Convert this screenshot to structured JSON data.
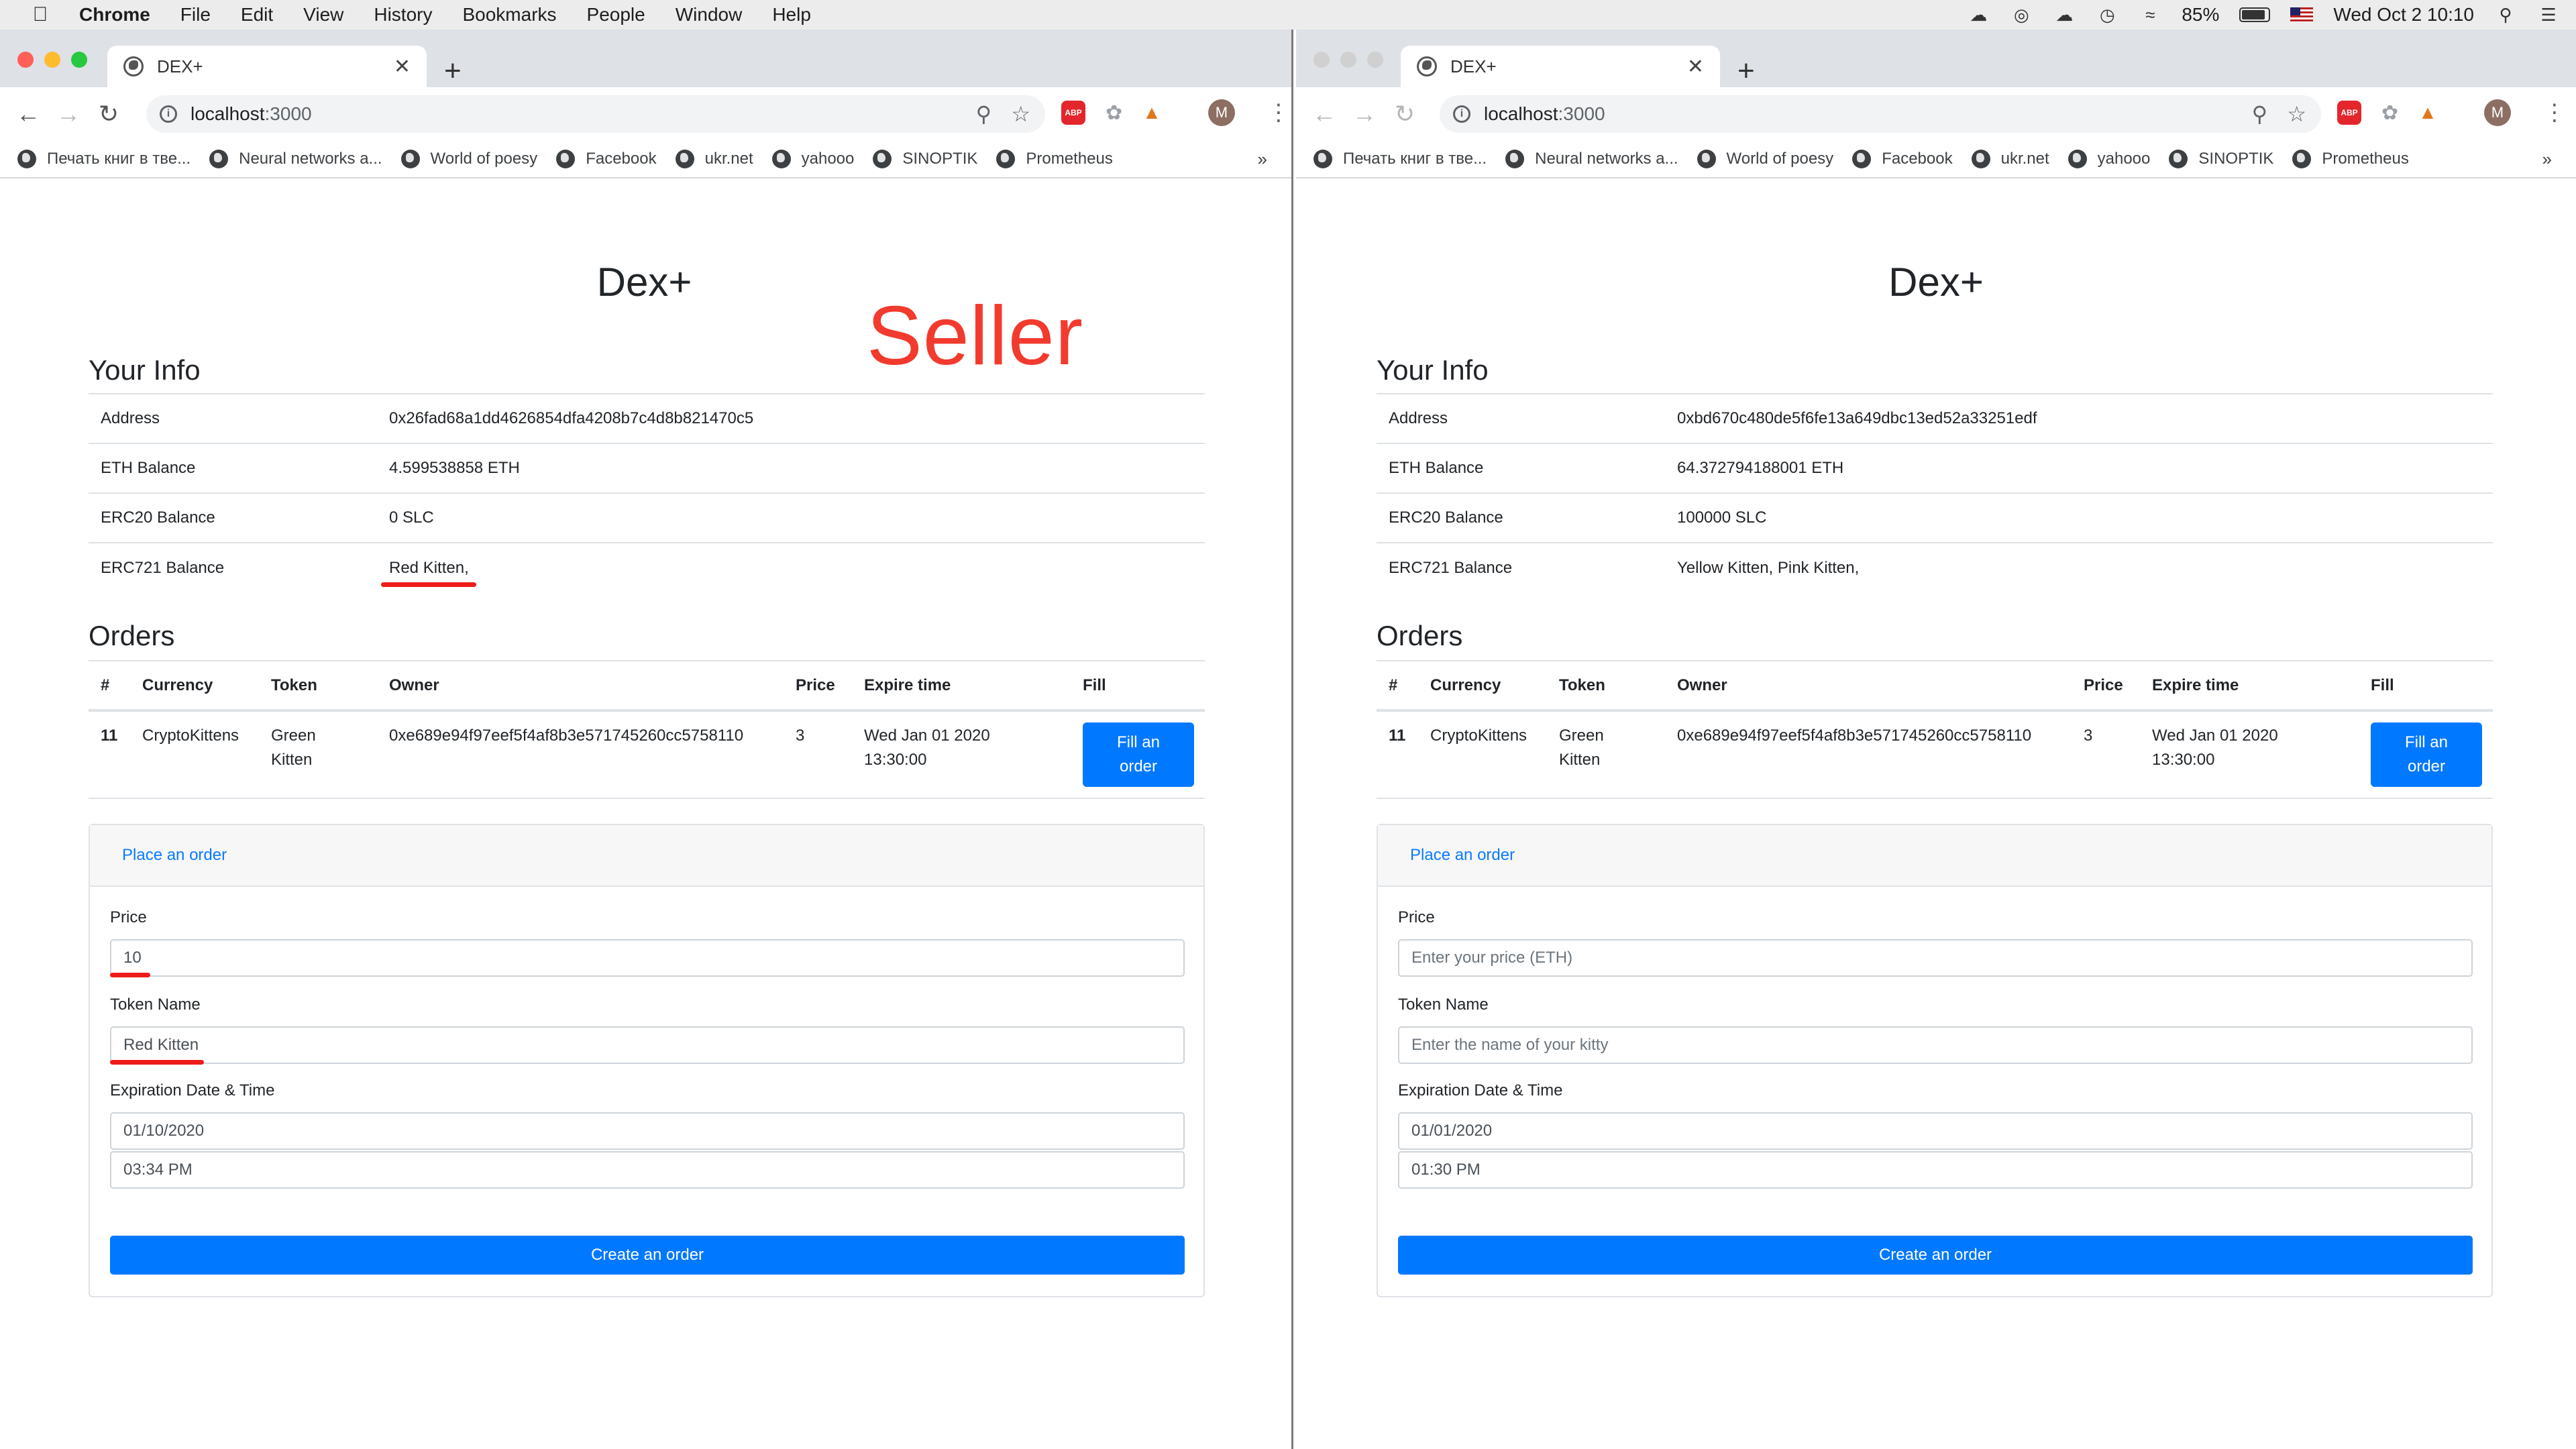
{
  "menubar": {
    "app": "Chrome",
    "items": [
      "File",
      "Edit",
      "View",
      "History",
      "Bookmarks",
      "People",
      "Window",
      "Help"
    ],
    "battery": "85%",
    "datetime": "Wed Oct 2  10:10"
  },
  "browser": {
    "tab_title": "DEX+",
    "url_host": "localhost",
    "url_port": ":3000",
    "bookmarks": [
      "Печать книг в тве...",
      "Neural networks a...",
      "World of poesy",
      "Facebook",
      "ukr.net",
      "yahooo",
      "SINOPTIK",
      "Prometheus"
    ],
    "more": "»"
  },
  "app": {
    "brand": "Dex+",
    "your_info": "Your Info",
    "orders_title": "Orders",
    "info_labels": {
      "address": "Address",
      "eth": "ETH Balance",
      "erc20": "ERC20 Balance",
      "erc721": "ERC721 Balance"
    },
    "order_headers": [
      "#",
      "Currency",
      "Token",
      "Owner",
      "Price",
      "Expire time",
      "Fill"
    ],
    "order": {
      "id": "11",
      "currency": "CryptoKittens",
      "token_line1": "Green",
      "token_line2": "Kitten",
      "owner": "0xe689e94f97eef5f4af8b3e571745260cc5758110",
      "price": "3",
      "expire_line1": "Wed Jan 01 2020",
      "expire_line2": "13:30:00",
      "fill_line1": "Fill an",
      "fill_line2": "order"
    },
    "form": {
      "header": "Place an order",
      "price_label": "Price",
      "token_label": "Token Name",
      "exp_label": "Expiration Date & Time",
      "price_placeholder": "Enter your price (ETH)",
      "token_placeholder": "Enter the name of your kitty",
      "create": "Create an order"
    }
  },
  "left": {
    "annotation": "Seller",
    "address": "0x26fad68a1dd4626854dfa4208b7c4d8b821470c5",
    "eth": "4.599538858 ETH",
    "erc20": "0 SLC",
    "erc721": "Red Kitten,",
    "price_value": "10",
    "token_value": "Red Kitten",
    "date_value": "01/10/2020",
    "time_value": "03:34 PM"
  },
  "right": {
    "address": "0xbd670c480de5f6fe13a649dbc13ed52a33251edf",
    "eth": "64.372794188001 ETH",
    "erc20": "100000 SLC",
    "erc721": "Yellow Kitten, Pink Kitten,",
    "date_value": "01/01/2020",
    "time_value": "01:30 PM"
  },
  "colors": {
    "primary": "#0078ff",
    "annotation_red": "#f23b2e",
    "underline_red": "#ee1b1b"
  }
}
